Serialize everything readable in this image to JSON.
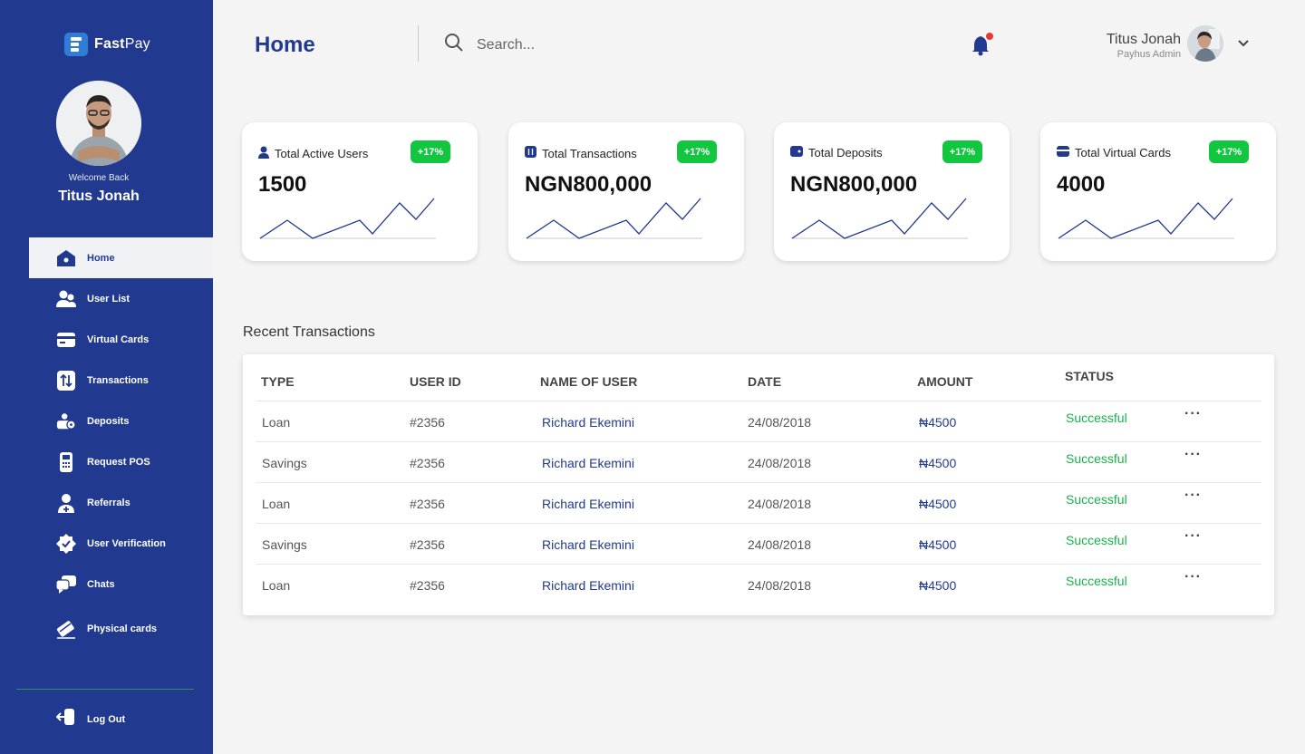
{
  "brand": {
    "name_bold": "Fast",
    "name_light": "Pay"
  },
  "sidebar": {
    "welcome": "Welcome Back",
    "user_name": "Titus Jonah",
    "items": [
      {
        "label": "Home",
        "icon": "home-icon"
      },
      {
        "label": "User List",
        "icon": "users-icon"
      },
      {
        "label": "Virtual Cards",
        "icon": "card-icon"
      },
      {
        "label": "Transactions",
        "icon": "transactions-icon"
      },
      {
        "label": "Deposits",
        "icon": "deposits-icon"
      },
      {
        "label": "Request POS",
        "icon": "pos-icon"
      },
      {
        "label": "Referrals",
        "icon": "referrals-icon"
      },
      {
        "label": "User Verification",
        "icon": "verification-icon"
      },
      {
        "label": "Chats",
        "icon": "chats-icon"
      },
      {
        "label": "Physical cards",
        "icon": "physical-card-icon"
      }
    ],
    "logout": "Log Out"
  },
  "header": {
    "title": "Home",
    "search_placeholder": "Search...",
    "user_name": "Titus Jonah",
    "user_role": "Payhus Admin"
  },
  "cards": [
    {
      "title": "Total Active Users",
      "value": "1500",
      "badge": "+17%"
    },
    {
      "title": "Total Transactions",
      "value": "NGN800,000",
      "badge": "+17%"
    },
    {
      "title": "Total Deposits",
      "value": "NGN800,000",
      "badge": "+17%"
    },
    {
      "title": "Total Virtual Cards",
      "value": "4000",
      "badge": "+17%"
    }
  ],
  "transactions": {
    "title": "Recent Transactions",
    "columns": [
      "TYPE",
      "USER ID",
      "NAME OF USER",
      "DATE",
      "AMOUNT",
      "STATUS"
    ],
    "rows": [
      {
        "type": "Loan",
        "user_id": "#2356",
        "name": "Richard Ekemini",
        "date": "24/08/2018",
        "amount": "₦4500",
        "status": "Successful"
      },
      {
        "type": "Savings",
        "user_id": "#2356",
        "name": "Richard Ekemini",
        "date": "24/08/2018",
        "amount": "₦4500",
        "status": "Successful"
      },
      {
        "type": "Loan",
        "user_id": "#2356",
        "name": "Richard Ekemini",
        "date": "24/08/2018",
        "amount": "₦4500",
        "status": "Successful"
      },
      {
        "type": "Savings",
        "user_id": "#2356",
        "name": "Richard Ekemini",
        "date": "24/08/2018",
        "amount": "₦4500",
        "status": "Successful"
      },
      {
        "type": "Loan",
        "user_id": "#2356",
        "name": "Richard Ekemini",
        "date": "24/08/2018",
        "amount": "₦4500",
        "status": "Successful"
      }
    ],
    "more": "···"
  },
  "colors": {
    "primary": "#213a8f",
    "success": "#16b34a",
    "badge": "#12c63f",
    "notification_dot": "#e53935"
  }
}
